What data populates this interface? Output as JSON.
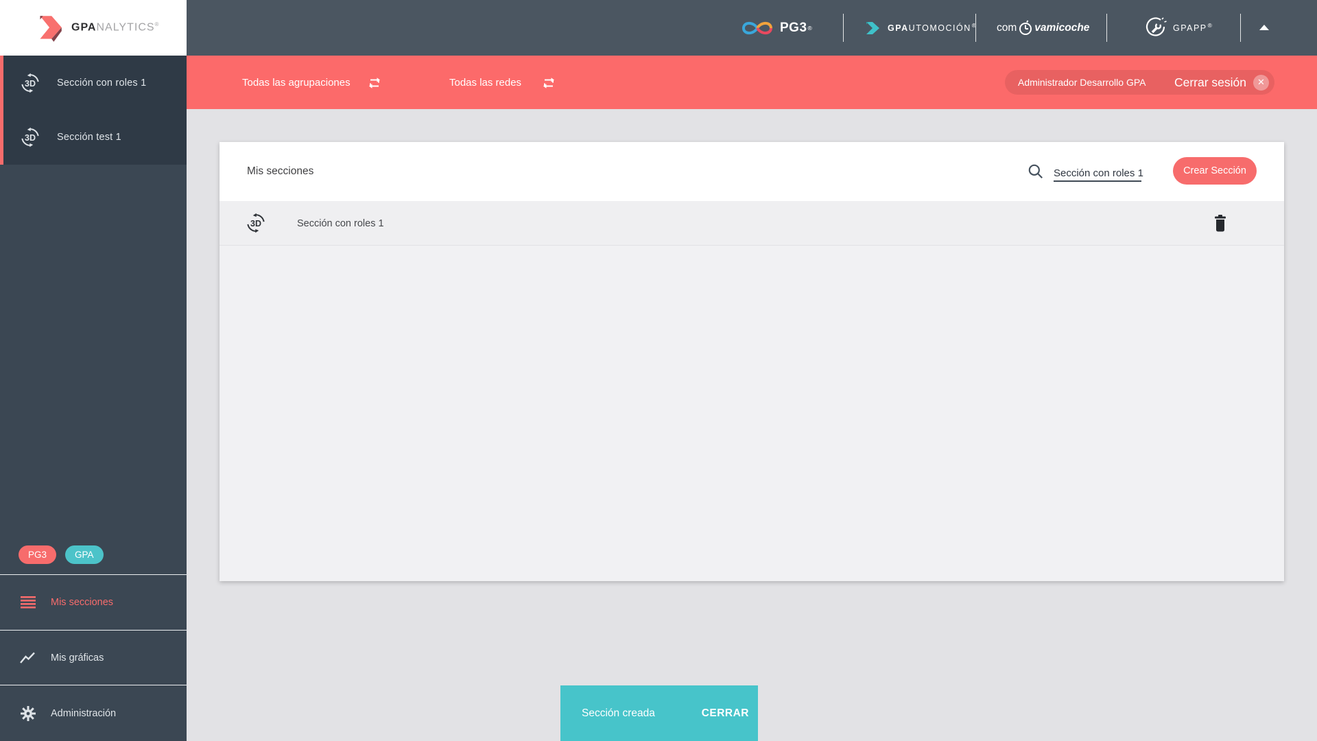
{
  "colors": {
    "coral": "#f76c6c",
    "coral_bar": "#fc6a6a",
    "teal": "#47c4ca",
    "header_bg": "#4b5661",
    "sidebar_bg": "#3b4753",
    "sidebar_group_bg": "#2f3a46"
  },
  "sidebar": {
    "logo": {
      "part1": "GPA",
      "part2": "NALYTICS",
      "reg": "®"
    },
    "sections": [
      {
        "label": "Sección con roles 1",
        "icon": "3d-rotation-icon"
      },
      {
        "label": "Sección test 1",
        "icon": "3d-rotation-icon"
      }
    ],
    "badges": [
      {
        "label": "PG3"
      },
      {
        "label": "GPA"
      }
    ],
    "nav": [
      {
        "label": "Mis secciones",
        "icon": "menu-icon",
        "active": true
      },
      {
        "label": "Mis gráficas",
        "icon": "line-chart-icon",
        "active": false
      },
      {
        "label": "Administración",
        "icon": "gear-icon",
        "active": false
      }
    ]
  },
  "header": {
    "brand_pg3": {
      "name": "PG3",
      "reg": "®"
    },
    "brand_automocion": {
      "bold": "GPA",
      "rest": "UTOMOCIÓN",
      "reg": "®"
    },
    "brand_compravamicoche": {
      "part1": "com",
      "part2": "vamicoche",
      "icon": "clock-icon"
    },
    "brand_gpapp": {
      "name": "GPAPP",
      "reg": "®"
    }
  },
  "filter_bar": {
    "groupings_label": "Todas las agrupaciones",
    "networks_label": "Todas las redes",
    "user_label": "Administrador Desarrollo GPA",
    "logout_label": "Cerrar sesión",
    "logout_x": "✕"
  },
  "main": {
    "title": "Mis secciones",
    "search_value": "Sección con roles 1",
    "create_button": "Crear Sección",
    "rows": [
      {
        "label": "Sección con roles 1",
        "icon": "3d-rotation-icon",
        "action_icon": "trash-icon"
      }
    ]
  },
  "toast": {
    "message": "Sección creada",
    "action": "CERRAR"
  }
}
